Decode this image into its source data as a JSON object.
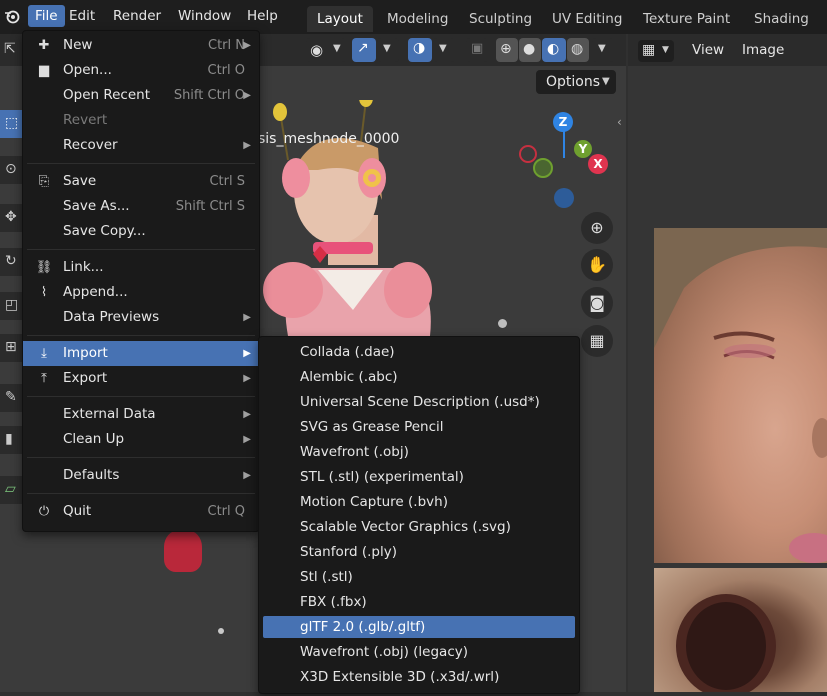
{
  "top_menu": [
    {
      "label": "File",
      "active": true
    },
    {
      "label": "Edit"
    },
    {
      "label": "Render"
    },
    {
      "label": "Window"
    },
    {
      "label": "Help"
    }
  ],
  "workspace_tabs": [
    {
      "label": "Layout",
      "active": true
    },
    {
      "label": "Modeling"
    },
    {
      "label": "Sculpting"
    },
    {
      "label": "UV Editing"
    },
    {
      "label": "Texture Paint"
    },
    {
      "label": "Shading"
    }
  ],
  "viewport": {
    "options_label": "Options",
    "object_name": "sis_meshnode_0000",
    "gizmo_axes": {
      "z": "Z",
      "y": "Y",
      "x": "X"
    }
  },
  "image_editor": {
    "view_label": "View",
    "image_label": "Image"
  },
  "file_menu": {
    "items": [
      {
        "label": "New",
        "shortcut": "Ctrl N",
        "arrow": "▶",
        "icon": "new-file-icon",
        "glyph": "✚"
      },
      {
        "label": "Open...",
        "shortcut": "Ctrl O",
        "icon": "folder-icon",
        "glyph": "▆"
      },
      {
        "label": "Open Recent",
        "shortcut": "Shift Ctrl O",
        "arrow": "▶"
      },
      {
        "label": "Revert",
        "disabled": true
      },
      {
        "label": "Recover",
        "arrow": "▶"
      },
      {
        "label": "Save",
        "shortcut": "Ctrl S",
        "icon": "save-icon",
        "glyph": "⎘"
      },
      {
        "label": "Save As...",
        "shortcut": "Shift Ctrl S"
      },
      {
        "label": "Save Copy..."
      },
      {
        "label": "Link...",
        "icon": "link-icon",
        "glyph": "⛓"
      },
      {
        "label": "Append...",
        "icon": "paperclip-icon",
        "glyph": "⌇"
      },
      {
        "label": "Data Previews",
        "arrow": "▶"
      },
      {
        "label": "Import",
        "arrow": "▶",
        "icon": "import-icon",
        "glyph": "⤓",
        "highlighted": true
      },
      {
        "label": "Export",
        "arrow": "▶",
        "icon": "export-icon",
        "glyph": "⤒"
      },
      {
        "label": "External Data",
        "arrow": "▶"
      },
      {
        "label": "Clean Up",
        "arrow": "▶"
      },
      {
        "label": "Defaults",
        "arrow": "▶"
      },
      {
        "label": "Quit",
        "shortcut": "Ctrl Q",
        "icon": "power-icon",
        "glyph": "⏻"
      }
    ]
  },
  "import_menu": {
    "items": [
      {
        "label": "Collada (.dae)"
      },
      {
        "label": "Alembic (.abc)"
      },
      {
        "label": "Universal Scene Description (.usd*)"
      },
      {
        "label": "SVG as Grease Pencil"
      },
      {
        "label": "Wavefront (.obj)"
      },
      {
        "label": "STL (.stl) (experimental)"
      },
      {
        "label": "Motion Capture (.bvh)"
      },
      {
        "label": "Scalable Vector Graphics (.svg)"
      },
      {
        "label": "Stanford (.ply)"
      },
      {
        "label": "Stl (.stl)"
      },
      {
        "label": "FBX (.fbx)"
      },
      {
        "label": "glTF 2.0 (.glb/.gltf)",
        "highlighted": true
      },
      {
        "label": "Wavefront (.obj) (legacy)"
      },
      {
        "label": "X3D Extensible 3D (.x3d/.wrl)"
      }
    ]
  },
  "colors": {
    "accent": "#4772b3",
    "menu_bg": "#1a1a1a",
    "axis_x": "#e0344f",
    "axis_y": "#6fa02f",
    "axis_z": "#2f84e3"
  }
}
